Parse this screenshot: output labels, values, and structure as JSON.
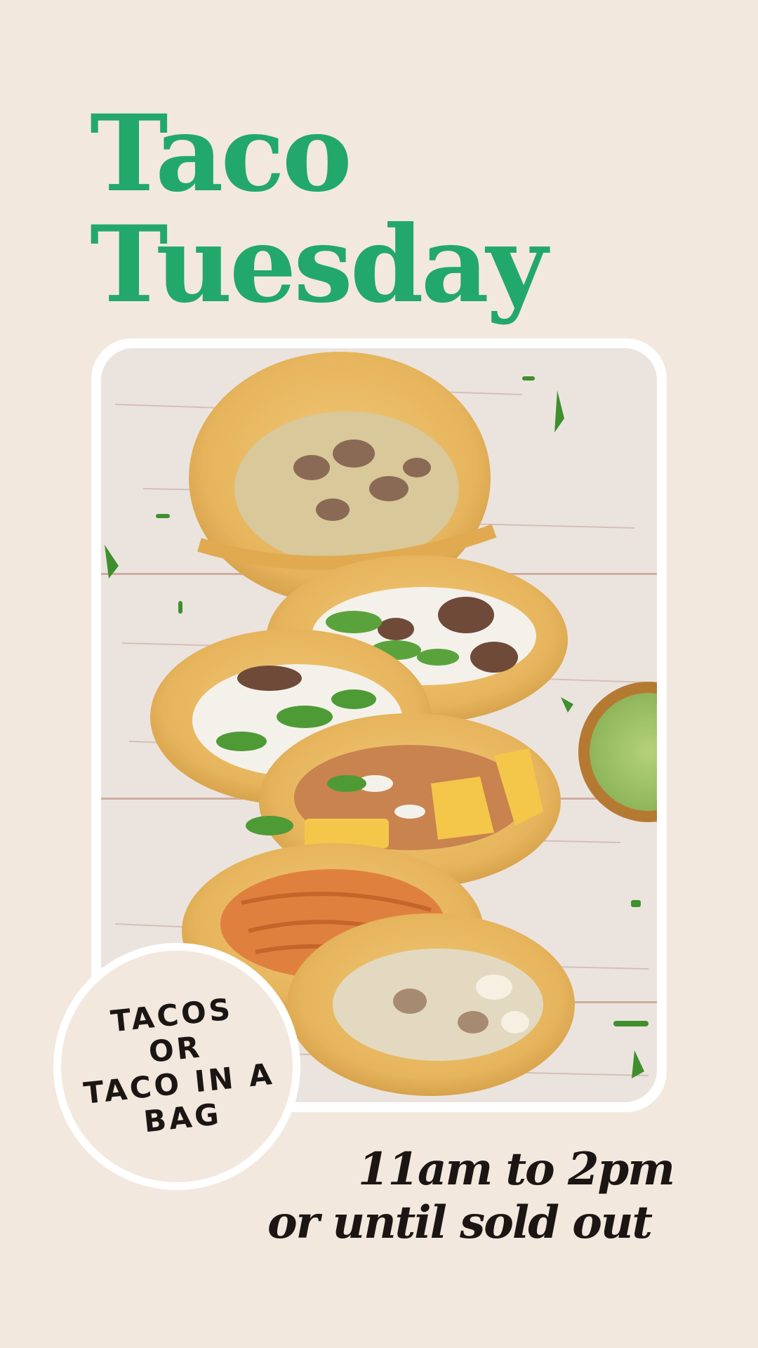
{
  "title": {
    "line1": "Taco",
    "line2": "Tuesday"
  },
  "badge": {
    "lines": [
      "TACOS",
      "OR",
      "TACO IN A",
      "BAG"
    ]
  },
  "hours": {
    "line1": "11am to 2pm",
    "line2": "or until sold out"
  },
  "colors": {
    "background": "#f3e8de",
    "title": "#22a86b",
    "text": "#1b1613",
    "frame": "#ffffff"
  },
  "photo": {
    "subject": "tacos-photo"
  }
}
